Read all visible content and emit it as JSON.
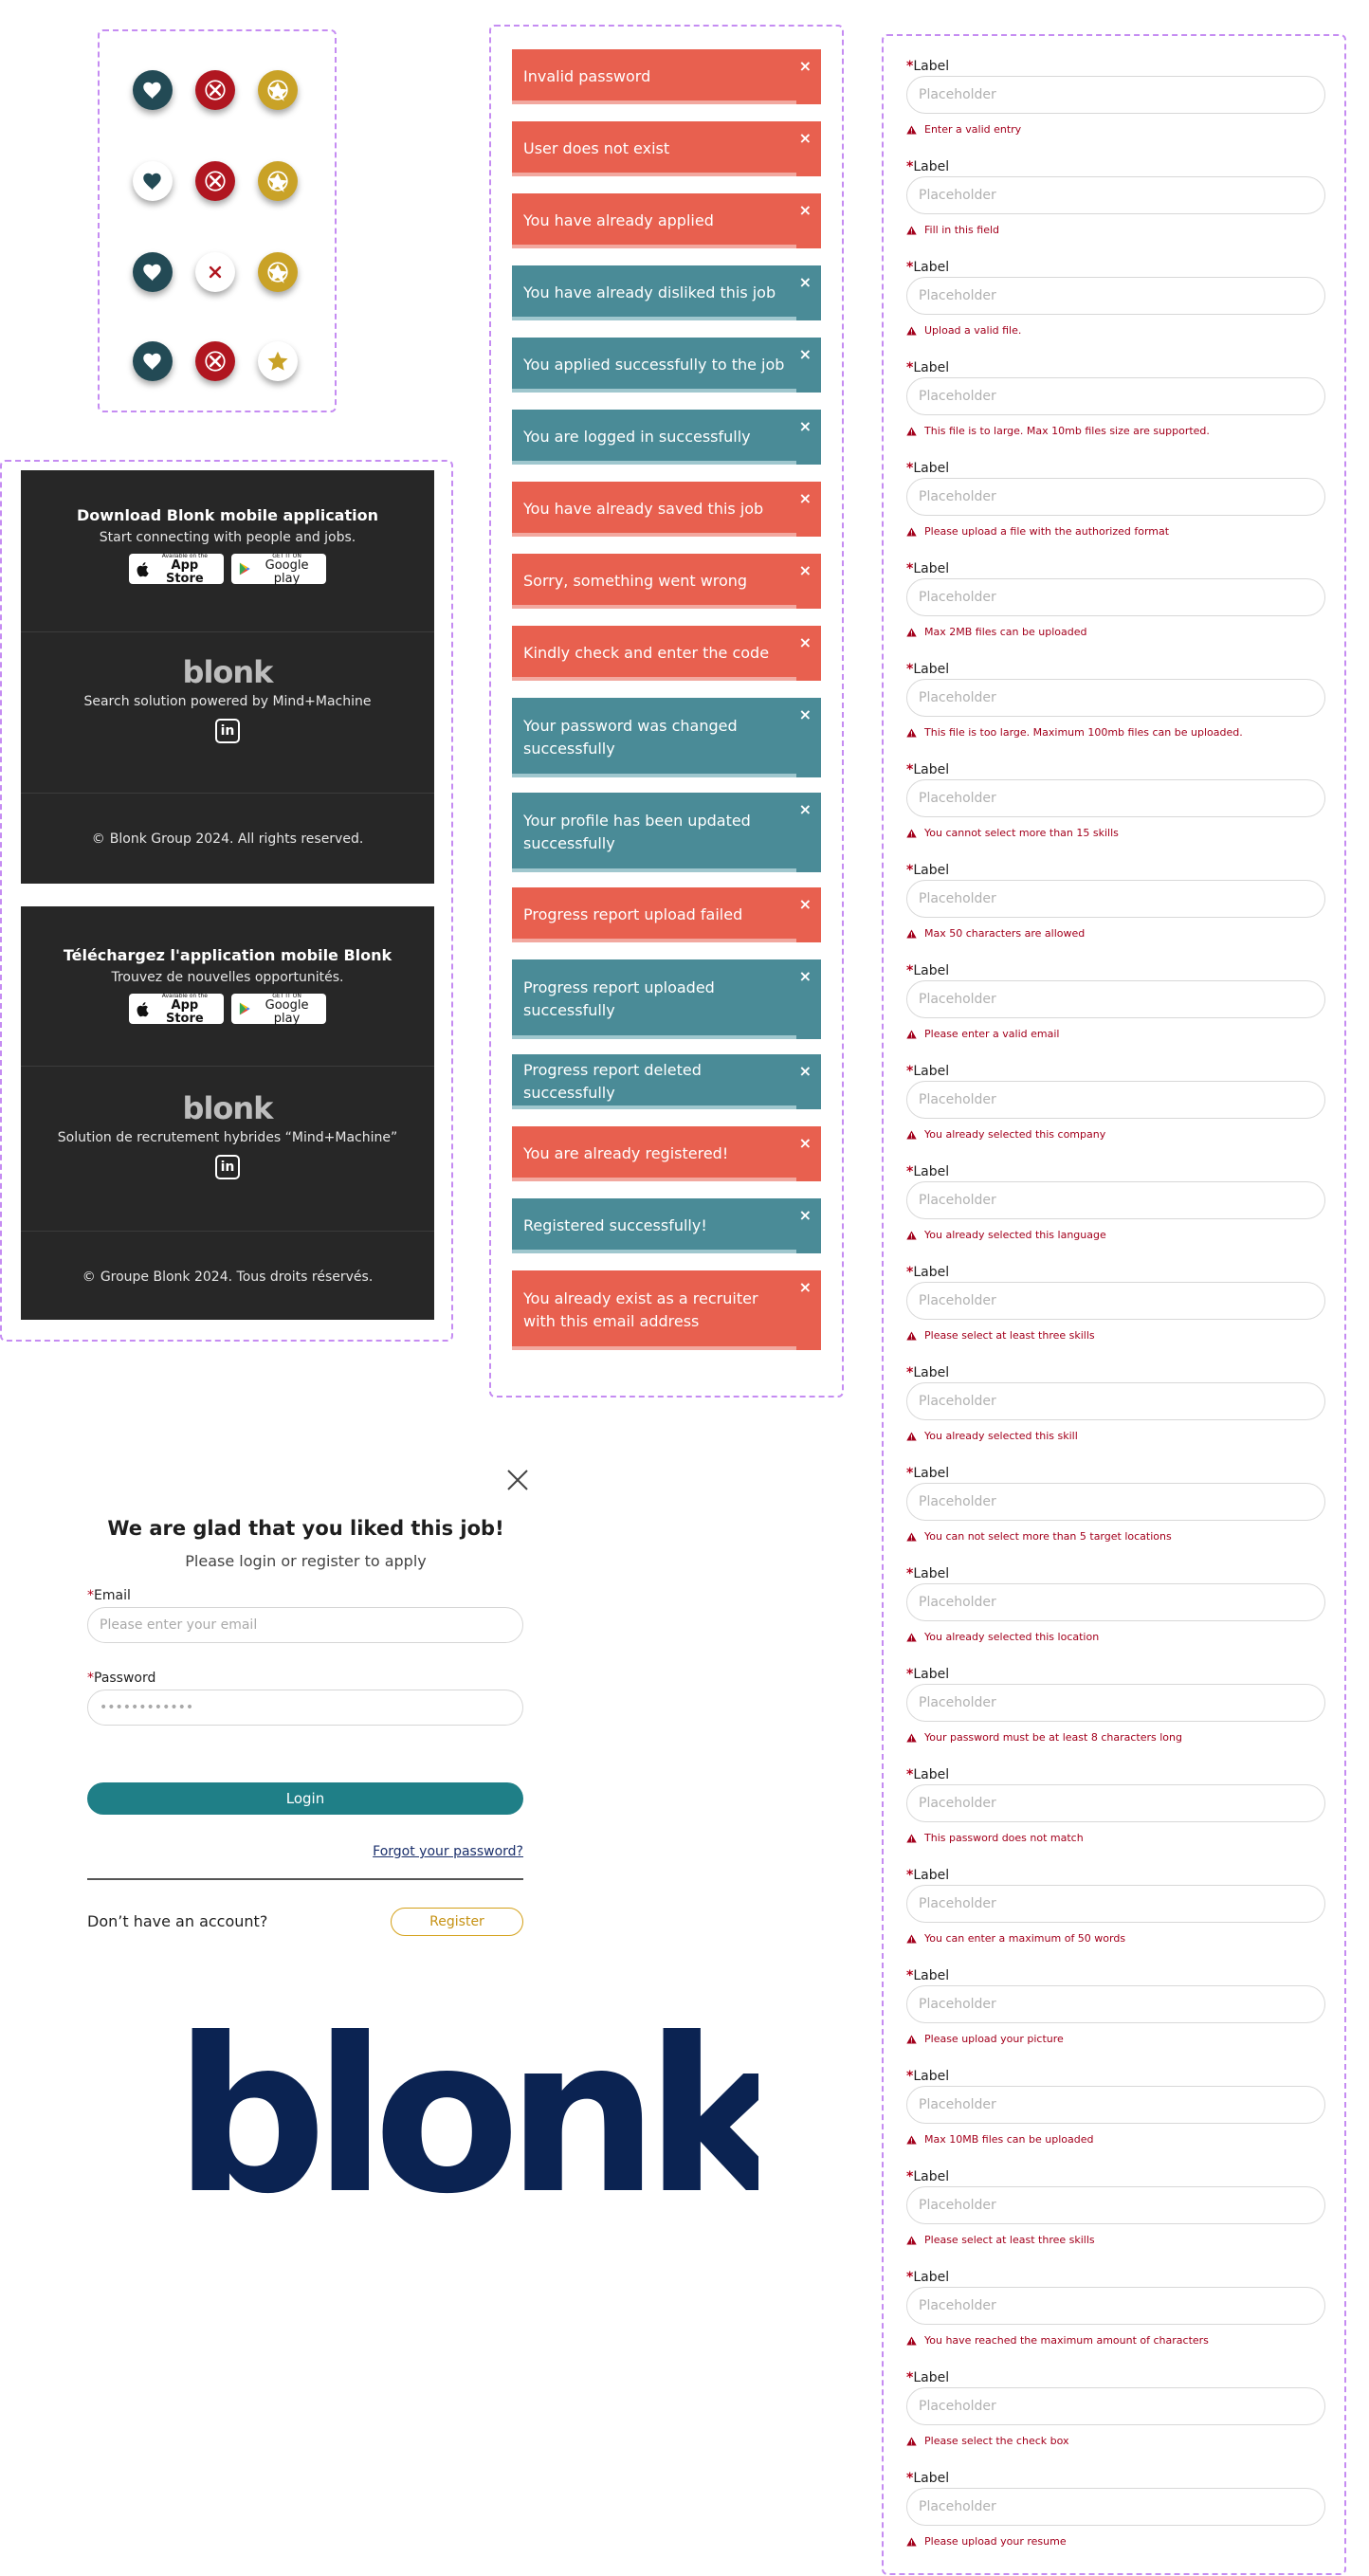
{
  "colors": {
    "error_red": "#e8604f",
    "success_teal": "#4a8b97",
    "login_button": "#1f7f87",
    "register_accent": "#d4a017",
    "footer_bg": "#272727",
    "logo_navy": "#0b2352",
    "validation_red": "#a3001c",
    "panel_border": "#c58cf2"
  },
  "icons_grid": {
    "rows": [
      [
        "heart-icon-filled",
        "close-icon-filled",
        "star-icon-filled"
      ],
      [
        "heart-icon-outline",
        "close-icon-filled",
        "star-icon-filled"
      ],
      [
        "heart-icon-filled",
        "close-icon-outline",
        "star-icon-filled"
      ],
      [
        "heart-icon-filled",
        "close-icon-filled",
        "star-icon-outline"
      ]
    ]
  },
  "footer_en": {
    "title": "Download Blonk mobile application",
    "subtitle": "Start connecting with people and jobs.",
    "app_store_small": "Available on the",
    "app_store_big": "App Store",
    "google_play_small": "GET IT ON",
    "google_play_big": "Google play",
    "logo": "blonk",
    "tagline": "Search solution powered by Mind+Machine",
    "linkedin": "in",
    "copyright_symbol": "©",
    "copyright": "Blonk Group 2024. All rights reserved."
  },
  "footer_fr": {
    "title": "Téléchargez l'application mobile Blonk",
    "subtitle": "Trouvez de nouvelles opportunités.",
    "app_store_small": "Available on the",
    "app_store_big": "App Store",
    "google_play_small": "GET IT ON",
    "google_play_big": "Google play",
    "logo": "blonk",
    "tagline": "Solution de recrutement hybrides “Mind+Machine”",
    "linkedin": "in",
    "copyright_symbol": "©",
    "copyright": "Groupe Blonk 2024. Tous droits réservés."
  },
  "toasts": [
    {
      "type": "error",
      "text": "Invalid password"
    },
    {
      "type": "error",
      "text": "User does not exist"
    },
    {
      "type": "error",
      "text": "You have already applied"
    },
    {
      "type": "success",
      "text": "You have already disliked this job"
    },
    {
      "type": "success",
      "text": "You applied successfully to the job"
    },
    {
      "type": "success",
      "text": "You are logged in successfully"
    },
    {
      "type": "error",
      "text": "You have already saved this job"
    },
    {
      "type": "error",
      "text": "Sorry, something went wrong"
    },
    {
      "type": "error",
      "text": "Kindly check and enter the code"
    },
    {
      "type": "success",
      "text": "Your password was changed successfully"
    },
    {
      "type": "success",
      "text": "Your profile has been updated successfully"
    },
    {
      "type": "error",
      "text": "Progress report upload failed"
    },
    {
      "type": "success",
      "text": "Progress report uploaded successfully"
    },
    {
      "type": "success",
      "text": "Progress report deleted successfully"
    },
    {
      "type": "error",
      "text": "You are already registered!"
    },
    {
      "type": "success",
      "text": "Registered successfully!"
    },
    {
      "type": "error",
      "text": "You already exist as a recruiter with this email address"
    }
  ],
  "toast_close": "×",
  "login": {
    "title": "We are glad that you liked this job!",
    "subtitle": "Please login or register to apply",
    "required_mark": "*",
    "email_label": "Email",
    "email_placeholder": "Please enter your email",
    "password_label": "Password",
    "password_placeholder": "••••••••••••",
    "login_button": "Login",
    "forgot_link": "Forgot your password?",
    "no_account": "Don’t have an account?",
    "register_button": "Register"
  },
  "big_logo": "blonk",
  "form": {
    "required_mark": "*",
    "label": "Label",
    "placeholder": "Placeholder",
    "errors": [
      "Enter a valid entry",
      "Fill in this field",
      "Upload a valid file.",
      "This file is to large. Max 10mb files size are supported.",
      "Please upload a file with the authorized format",
      "Max 2MB files can be uploaded",
      "This file is too large. Maximum 100mb files can be uploaded.",
      "You cannot select more than 15 skills",
      "Max 50 characters are allowed",
      "Please enter a valid email",
      "You already selected this company",
      "You already selected this language",
      "Please select at least three skills",
      "You already selected this skill",
      "You can not select more than 5 target locations",
      "You already selected this location",
      "Your password must be at least 8 characters long",
      "This password does not match",
      "You can enter a maximum of 50 words",
      "Please upload your picture",
      "Max 10MB files can be uploaded",
      "Please select at least three skills",
      "You have reached the maximum amount of characters",
      "Please select the check box",
      "Please upload your resume"
    ]
  }
}
